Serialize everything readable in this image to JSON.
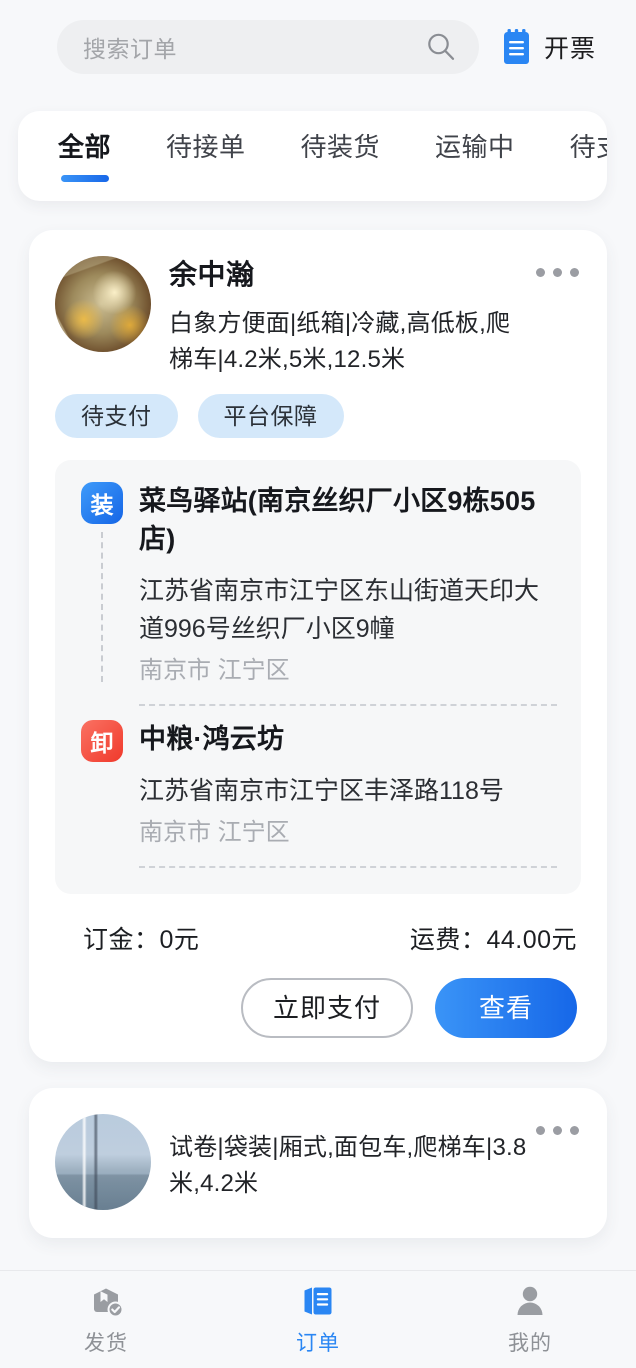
{
  "search": {
    "placeholder": "搜索订单",
    "icon": "search-icon"
  },
  "invoice": {
    "label": "开票",
    "icon": "invoice-clipboard-icon"
  },
  "tabs": [
    {
      "label": "全部",
      "active": true
    },
    {
      "label": "待接单",
      "active": false
    },
    {
      "label": "待装货",
      "active": false
    },
    {
      "label": "运输中",
      "active": false
    },
    {
      "label": "待支付",
      "active": false
    }
  ],
  "orders": [
    {
      "shipper": "余中瀚",
      "cargo": "白象方便面|纸箱|冷藏,高低板,爬梯车|4.2米,5米,12.5米",
      "badges": [
        "待支付",
        "平台保障"
      ],
      "more_icon": "more-dots-icon",
      "route": {
        "load": {
          "marker": "装",
          "title": "菜鸟驿站(南京丝织厂小区9栋505店)",
          "address": "江苏省南京市江宁区东山街道天印大道996号丝织厂小区9幢",
          "region": "南京市 江宁区"
        },
        "unload": {
          "marker": "卸",
          "title": "中粮·鸿云坊",
          "address": "江苏省南京市江宁区丰泽路118号",
          "region": "南京市 江宁区"
        }
      },
      "deposit_label": "订金：",
      "deposit_value": "0元",
      "freight_label": "运费：",
      "freight_value": "44.00元",
      "pay_button": "立即支付",
      "view_button": "查看"
    },
    {
      "shipper": "",
      "cargo": "试卷|袋装|厢式,面包车,爬梯车|3.8米,4.2米",
      "more_icon": "more-dots-icon"
    }
  ],
  "bottom_nav": [
    {
      "label": "发货",
      "icon": "package-check-icon",
      "active": false
    },
    {
      "label": "订单",
      "icon": "order-list-icon",
      "active": true
    },
    {
      "label": "我的",
      "icon": "user-profile-icon",
      "active": false
    }
  ],
  "colors": {
    "accent_blue": "#1667e8",
    "badge_bg": "#d4e8fa",
    "unload_red": "#f0392b",
    "page_bg": "#f7f8fa"
  }
}
